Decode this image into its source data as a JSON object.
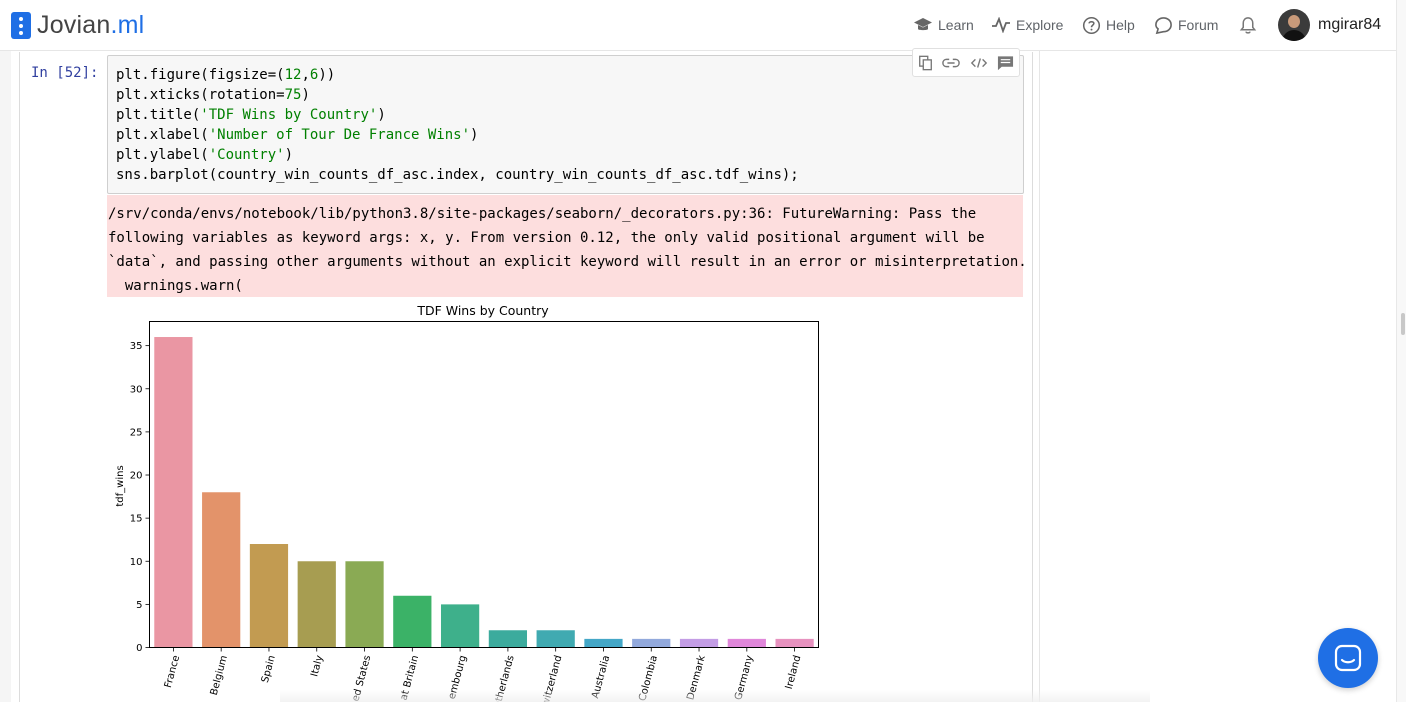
{
  "app": {
    "logo_text": "Jovian",
    "logo_suffix": ".ml",
    "accent": "#1f6fe5"
  },
  "nav": {
    "learn": "Learn",
    "explore": "Explore",
    "help": "Help",
    "forum": "Forum",
    "username": "mgirar84"
  },
  "cell": {
    "prompt": "In [52]:",
    "code_lines": [
      "plt.figure(figsize=(12,6))",
      "plt.xticks(rotation=75)",
      "plt.title('TDF Wins by Country')",
      "plt.xlabel('Number of Tour De France Wins')",
      "plt.ylabel('Country')",
      "sns.barplot(country_win_counts_df_asc.index, country_win_counts_df_asc.tdf_wins);"
    ],
    "warning_lines": [
      "/srv/conda/envs/notebook/lib/python3.8/site-packages/seaborn/_decorators.py:36: FutureWarning: Pass the",
      "following variables as keyword args: x, y. From version 0.12, the only valid positional argument will be",
      "`data`, and passing other arguments without an explicit keyword will result in an error or misinterpretation.",
      "  warnings.warn("
    ],
    "warning_bg": "#fddede"
  },
  "chart_data": {
    "type": "bar",
    "title": "TDF Wins by Country",
    "xlabel": "",
    "ylabel": "tdf_wins",
    "ylim": [
      0,
      37.8
    ],
    "yticks": [
      0,
      5,
      10,
      15,
      20,
      25,
      30,
      35
    ],
    "tick_rotation": 75,
    "categories": [
      "France",
      "Belgium",
      "Spain",
      "Italy",
      "United States",
      "Great Britain",
      "Luxembourg",
      "Netherlands",
      "Switzerland",
      "Australia",
      "Colombia",
      "Denmark",
      "Germany",
      "Ireland"
    ],
    "visible_tick_labels": [
      "France",
      "Belgium",
      "Spain",
      "Italy",
      "ed States",
      "at Britain",
      "embourg",
      "etherlands",
      "witzerland",
      "Australia",
      "Colombia",
      "Denmark",
      "Germany",
      "Ireland"
    ],
    "values": [
      36,
      18,
      12,
      10,
      10,
      6,
      5,
      2,
      2,
      1,
      1,
      1,
      1,
      1
    ],
    "colors": [
      "#ea96a3",
      "#e3936a",
      "#c29b51",
      "#a79d51",
      "#8aaa54",
      "#3bb267",
      "#3eb08b",
      "#3cab9d",
      "#40aab1",
      "#44a7c7",
      "#92a9dc",
      "#c39de5",
      "#e087da",
      "#e792bf"
    ],
    "grid": false,
    "legend": "none"
  }
}
